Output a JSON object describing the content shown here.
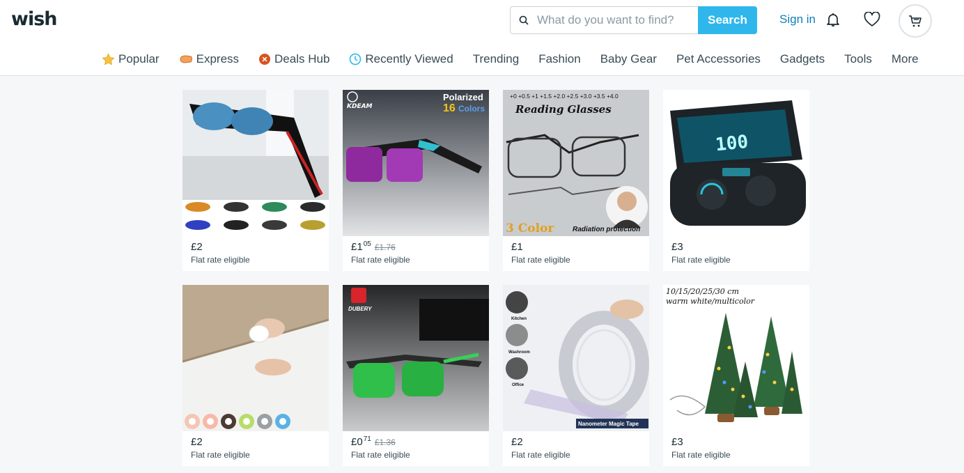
{
  "brand": {
    "logo": "wish"
  },
  "search": {
    "placeholder": "What do you want to find?",
    "button": "Search"
  },
  "account": {
    "signin": "Sign in"
  },
  "nav": [
    {
      "label": "Popular",
      "icon": "star-icon"
    },
    {
      "label": "Express",
      "icon": "express-icon"
    },
    {
      "label": "Deals Hub",
      "icon": "deals-icon"
    },
    {
      "label": "Recently Viewed",
      "icon": "clock-icon"
    },
    {
      "label": "Trending"
    },
    {
      "label": "Fashion"
    },
    {
      "label": "Baby Gear"
    },
    {
      "label": "Pet Accessories"
    },
    {
      "label": "Gadgets"
    },
    {
      "label": "Tools"
    },
    {
      "label": "More"
    }
  ],
  "products": [
    {
      "price": "£2",
      "cents": "",
      "old": "",
      "flat": "Flat rate eligible",
      "image": "sport-sunglasses"
    },
    {
      "price": "£1",
      "cents": "05",
      "old": "£1.76",
      "flat": "Flat rate eligible",
      "image": "polarized-sunglasses",
      "overlay": [
        "Polarized",
        "16",
        "Colors"
      ]
    },
    {
      "price": "£1",
      "cents": "",
      "old": "",
      "flat": "Flat rate eligible",
      "image": "reading-glasses",
      "overlay": [
        "+0 +0.5 +1 +1.5 +2.0 +2.5 +3.0 +3.5 +4.0",
        "Reading Glasses",
        "3 Color",
        "Radiation protection"
      ]
    },
    {
      "price": "£3",
      "cents": "",
      "old": "",
      "flat": "Flat rate eligible",
      "image": "wireless-earbuds"
    },
    {
      "price": "£2",
      "cents": "",
      "old": "",
      "flat": "Flat rate eligible",
      "image": "sealing-tape"
    },
    {
      "price": "£0",
      "cents": "71",
      "old": "£1.36",
      "flat": "Flat rate eligible",
      "image": "green-sunglasses",
      "overlay": [
        "DUBERY"
      ]
    },
    {
      "price": "£2",
      "cents": "",
      "old": "",
      "flat": "Flat rate eligible",
      "image": "nano-tape",
      "overlay": [
        "Kitchen",
        "Washroom",
        "Office",
        "Nanometer Magic Tape"
      ]
    },
    {
      "price": "£3",
      "cents": "",
      "old": "",
      "flat": "Flat rate eligible",
      "image": "christmas-trees",
      "overlay": [
        "10/15/20/25/30 cm",
        "warm white/multicolor"
      ]
    }
  ],
  "colors": {
    "accent": "#2fb7ec",
    "link": "#0d7fb8",
    "text": "#192a32",
    "background": "#f6f7f8"
  }
}
